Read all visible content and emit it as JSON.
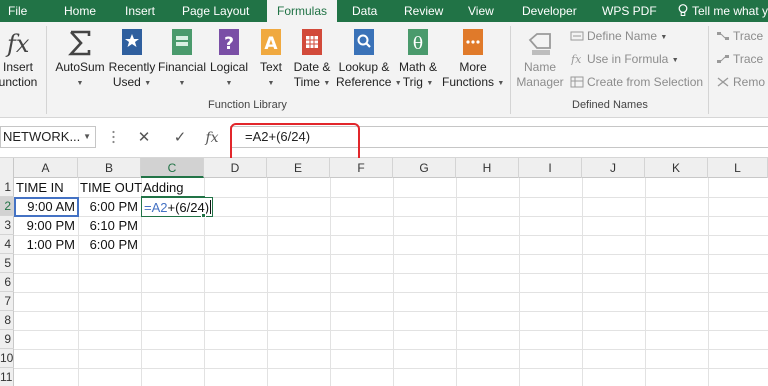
{
  "tabs": {
    "file": "File",
    "home": "Home",
    "insert": "Insert",
    "page_layout": "Page Layout",
    "formulas": "Formulas",
    "data": "Data",
    "review": "Review",
    "view": "View",
    "developer": "Developer",
    "wps_pdf": "WPS PDF",
    "tell_me": "Tell me what y"
  },
  "ribbon": {
    "insert_function": {
      "line1": "Insert",
      "line2": "unction"
    },
    "autosum": {
      "line1": "AutoSum"
    },
    "recently_used": {
      "line1": "Recently",
      "line2": "Used"
    },
    "financial": {
      "line1": "Financial"
    },
    "logical": {
      "line1": "Logical"
    },
    "text": {
      "line1": "Text"
    },
    "date_time": {
      "line1": "Date &",
      "line2": "Time"
    },
    "lookup_reference": {
      "line1": "Lookup &",
      "line2": "Reference"
    },
    "math_trig": {
      "line1": "Math &",
      "line2": "Trig"
    },
    "more_functions": {
      "line1": "More",
      "line2": "Functions"
    },
    "function_library_label": "Function Library",
    "name_manager": {
      "line1": "Name",
      "line2": "Manager"
    },
    "define_name": "Define Name",
    "use_in_formula": "Use in Formula",
    "create_from_selection": "Create from Selection",
    "defined_names_label": "Defined Names",
    "trace_precedents": "Trace",
    "trace_dependents": "Trace",
    "remove_arrows": "Remo"
  },
  "formula_bar": {
    "name_box": "NETWORK...",
    "cancel": "✕",
    "enter": "✓",
    "fx": "fx",
    "formula": "=A2+(6/24)"
  },
  "grid": {
    "columns": [
      "A",
      "B",
      "C",
      "D",
      "E",
      "F",
      "G",
      "H",
      "I",
      "J",
      "K",
      "L"
    ],
    "rows": [
      "1",
      "2",
      "3",
      "4",
      "5",
      "6",
      "7",
      "8",
      "9",
      "10",
      "11"
    ],
    "headers": {
      "a": "TIME IN",
      "b": "TIME OUT",
      "c": "Adding"
    },
    "data": [
      {
        "a": "9:00 AM",
        "b": "6:00 PM"
      },
      {
        "a": "9:00 PM",
        "b": "6:10 PM"
      },
      {
        "a": "1:00 PM",
        "b": "6:00 PM"
      }
    ],
    "edit_ref": "=A2",
    "edit_rest": "+(6/24)"
  },
  "colors": {
    "excel_green": "#217346",
    "reference_blue": "#4472c4",
    "highlight_red": "#e2262b"
  }
}
